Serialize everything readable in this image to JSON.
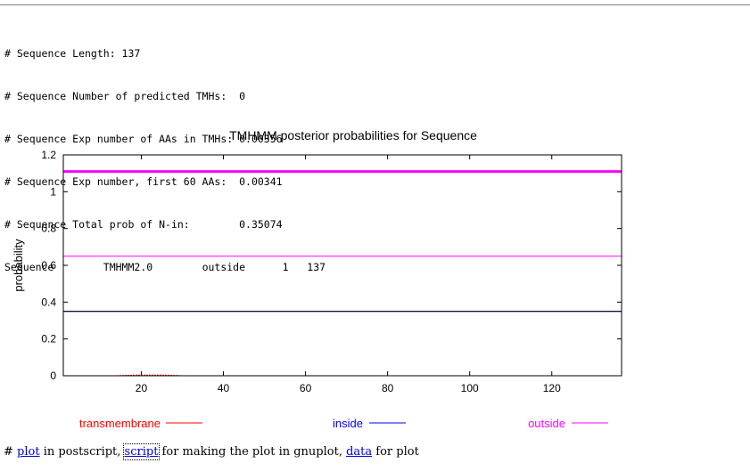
{
  "summary": {
    "lines": [
      "# Sequence Length: 137",
      "# Sequence Number of predicted TMHs:  0",
      "# Sequence Exp number of AAs in TMHs: 0.00356",
      "# Sequence Exp number, first 60 AAs:  0.00341",
      "# Sequence Total prob of N-in:        0.35074",
      "Sequence\tTMHMM2.0\toutside\t     1   137"
    ]
  },
  "chart_data": {
    "type": "line",
    "title": "TMHMM posterior probabilities for Sequence",
    "xlabel": "",
    "ylabel": "probability",
    "xlim": [
      1,
      137
    ],
    "ylim": [
      0,
      1.2
    ],
    "x_ticks": [
      20,
      40,
      60,
      80,
      100,
      120
    ],
    "y_ticks": [
      "0",
      "0.2",
      "0.4",
      "0.6",
      "0.8",
      "1",
      "1.2"
    ],
    "grid": false,
    "legend_position": "bottom",
    "series": [
      {
        "name": "transmembrane",
        "color": "#ff0000",
        "x": [
          1,
          14,
          15,
          16,
          18,
          20,
          22,
          24,
          26,
          28,
          29,
          30,
          137
        ],
        "y": [
          0,
          0,
          0.001,
          0.002,
          0.003,
          0.004,
          0.004,
          0.004,
          0.003,
          0.002,
          0.001,
          0,
          0
        ]
      },
      {
        "name": "inside",
        "color": "#0000ff",
        "x": [
          1,
          137
        ],
        "y": [
          0.35,
          0.35
        ]
      },
      {
        "name": "outside",
        "color": "#ff00ff",
        "x": [
          1,
          137
        ],
        "y": [
          0.65,
          0.65
        ]
      }
    ],
    "outside_region_bar": {
      "color": "#ff00ff",
      "y": 1.11,
      "x": [
        1,
        137
      ]
    }
  },
  "footer": {
    "hash": "# ",
    "link_plot": "plot",
    "text_1": " in postscript, ",
    "link_script": "script",
    "text_2": " for making the plot in gnuplot, ",
    "link_data": "data",
    "text_3": " for plot"
  }
}
